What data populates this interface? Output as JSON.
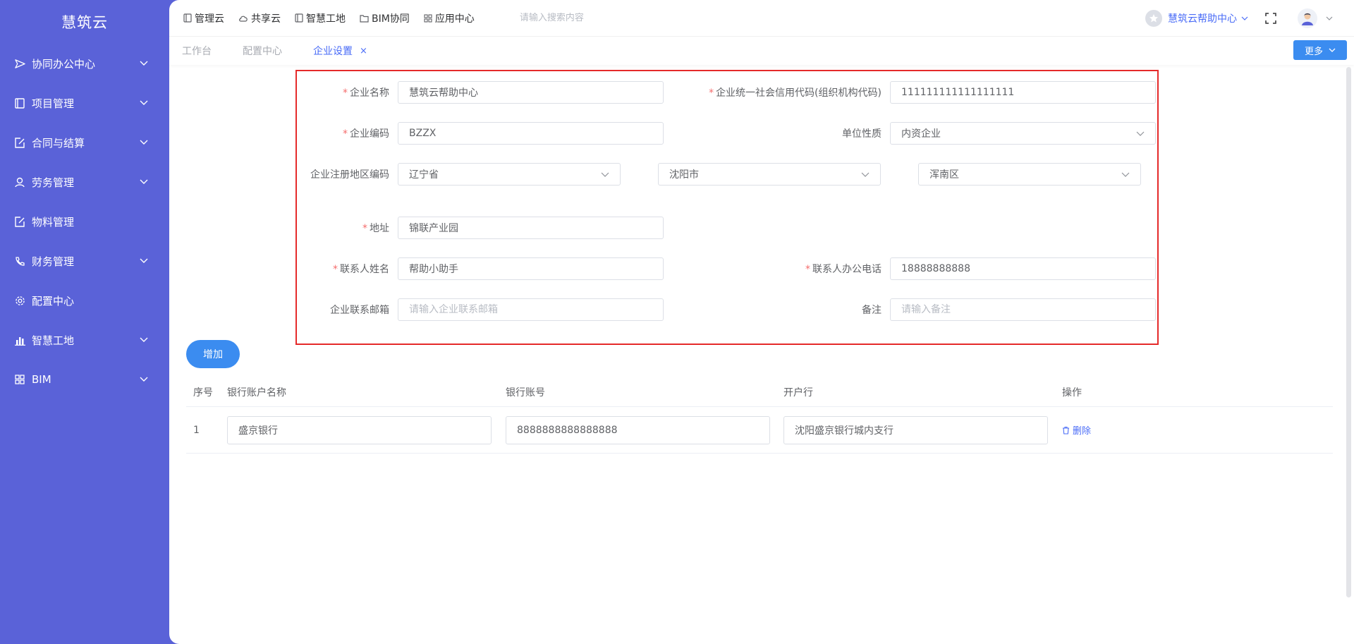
{
  "app": {
    "title": "慧筑云"
  },
  "sidebar": {
    "items": [
      {
        "label": "协同办公中心",
        "icon": "send-icon",
        "expandable": true
      },
      {
        "label": "项目管理",
        "icon": "book-icon",
        "expandable": true
      },
      {
        "label": "合同与结算",
        "icon": "edit-doc-icon",
        "expandable": true
      },
      {
        "label": "劳务管理",
        "icon": "worker-icon",
        "expandable": true
      },
      {
        "label": "物料管理",
        "icon": "edit-doc-icon",
        "expandable": false
      },
      {
        "label": "财务管理",
        "icon": "phone-icon",
        "expandable": true
      },
      {
        "label": "配置中心",
        "icon": "gear-icon",
        "expandable": false
      },
      {
        "label": "智慧工地",
        "icon": "bar-chart-icon",
        "expandable": true
      },
      {
        "label": "BIM",
        "icon": "grid-icon",
        "expandable": true
      }
    ]
  },
  "topnav": {
    "items": [
      {
        "label": "管理云",
        "icon": "doc-icon"
      },
      {
        "label": "共享云",
        "icon": "cloud-icon"
      },
      {
        "label": "智慧工地",
        "icon": "doc-icon"
      },
      {
        "label": "BIM协同",
        "icon": "folder-icon"
      },
      {
        "label": "应用中心",
        "icon": "grid-icon"
      }
    ],
    "search_placeholder": "请输入搜索内容",
    "user_name": "慧筑云帮助中心"
  },
  "tabs": {
    "items": [
      {
        "label": "工作台",
        "active": false
      },
      {
        "label": "配置中心",
        "active": false
      },
      {
        "label": "企业设置",
        "active": true,
        "close": "×"
      }
    ],
    "more_label": "更多"
  },
  "form": {
    "company_name": {
      "label": "企业名称",
      "value": "慧筑云帮助中心",
      "required": true
    },
    "credit_code": {
      "label": "企业统一社会信用代码(组织机构代码)",
      "value": "111111111111111111",
      "required": true
    },
    "company_code": {
      "label": "企业编码",
      "value": "BZZX",
      "required": true
    },
    "unit_nature": {
      "label": "单位性质",
      "value": "内资企业",
      "required": false
    },
    "region": {
      "label": "企业注册地区编码",
      "province": "辽宁省",
      "city": "沈阳市",
      "district": "浑南区"
    },
    "address": {
      "label": "地址",
      "value": "锦联产业园",
      "required": true
    },
    "contact_name": {
      "label": "联系人姓名",
      "value": "帮助小助手",
      "required": true
    },
    "contact_phone": {
      "label": "联系人办公电话",
      "value": "18888888888",
      "required": true
    },
    "email": {
      "label": "企业联系邮箱",
      "value": "",
      "placeholder": "请输入企业联系邮箱"
    },
    "remark": {
      "label": "备注",
      "value": "",
      "placeholder": "请输入备注"
    },
    "required_mark": "*"
  },
  "bank": {
    "add_label": "增加",
    "columns": [
      "序号",
      "银行账户名称",
      "银行账号",
      "开户行",
      "操作"
    ],
    "rows": [
      {
        "index": "1",
        "account_name": "盛京银行",
        "account_no": "8888888888888888",
        "bank_branch": "沈阳盛京银行城内支行",
        "action": "删除"
      }
    ]
  },
  "colors": {
    "sidebar_bg": "#5a62d8",
    "accent": "#4a6cf7",
    "button_blue": "#3b8cf0",
    "highlight_border": "#e52a2a",
    "required": "#f56c6c"
  }
}
